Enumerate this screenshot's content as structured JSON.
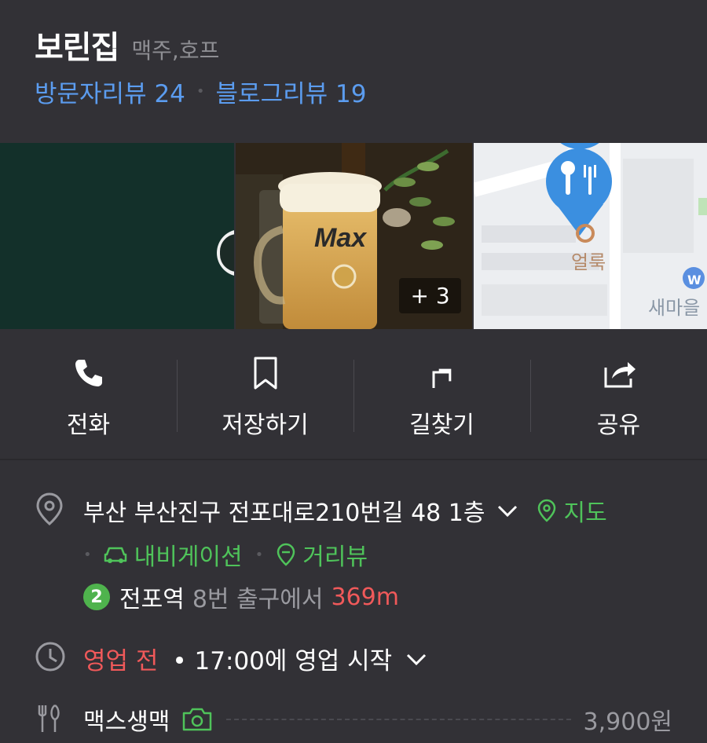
{
  "place": {
    "name": "보린집",
    "category": "맥주,호프"
  },
  "reviews": {
    "visitor": "방문자리뷰 24",
    "blog": "블로그리뷰 19"
  },
  "photos": {
    "more_count": "+ 3",
    "map_label": "얼룩",
    "map_label2": "새마을"
  },
  "actions": [
    {
      "label": "전화"
    },
    {
      "label": "저장하기"
    },
    {
      "label": "길찾기"
    },
    {
      "label": "공유"
    }
  ],
  "address": {
    "text": "부산 부산진구 전포대로210번길 48 1층",
    "map_link": "지도",
    "navigation": "내비게이션",
    "street_view": "거리뷰"
  },
  "subway": {
    "line": "2",
    "station": "전포역",
    "exit": "8번 출구에서",
    "distance": "369m"
  },
  "hours": {
    "status": "영업 전",
    "detail": "• 17:00에 영업 시작"
  },
  "menu": {
    "name": "맥스생맥",
    "price": "3,900원"
  },
  "colors": {
    "background": "#323136",
    "link_blue": "#5b9cef",
    "green": "#4fc35a",
    "status_red": "#f0595a",
    "map_pin": "#3b8fe0"
  }
}
